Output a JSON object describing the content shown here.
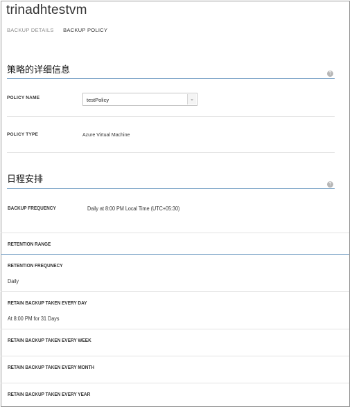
{
  "vm": {
    "title": "trinadhtestvm"
  },
  "tabs": [
    {
      "label": "BACKUP DETAILS",
      "active": false
    },
    {
      "label": "BACKUP POLICY",
      "active": true
    }
  ],
  "policy_details": {
    "section_title": "策略的详细信息",
    "help_glyph": "?",
    "policy_name_label": "POLICY NAME",
    "policy_name_value": "testPolicy",
    "policy_type_label": "POLICY TYPE",
    "policy_type_value": "Azure Virtual Machine"
  },
  "schedule": {
    "section_title": "日程安排",
    "help_glyph": "?",
    "backup_frequency_label": "BACKUP FREQUENCY",
    "backup_frequency_value": "Daily at 8:00 PM Local Time (UTC+05:30)"
  },
  "retention": {
    "range_label": "RETENTION RANGE",
    "frequency_label": "RETENTION FREQUNECY",
    "frequency_value": "Daily",
    "daily_label": "RETAIN BACKUP TAKEN EVERY DAY",
    "daily_value": "At 8:00 PM for 31 Days",
    "weekly_label": "RETAIN BACKUP TAKEN EVERY WEEK",
    "monthly_label": "RETAIN BACKUP TAKEN EVERY MONTH",
    "yearly_label": "RETAIN BACKUP TAKEN EVERY YEAR"
  },
  "colors": {
    "accent_line": "#7fa6c9",
    "help_icon": "#b7b7b7",
    "divider": "#e2e2e2"
  }
}
